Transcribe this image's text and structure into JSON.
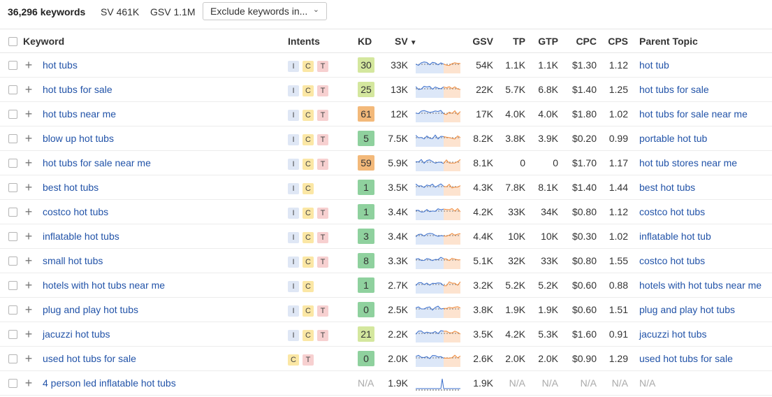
{
  "toolbar": {
    "keyword_count": "36,296 keywords",
    "sv": "SV 461K",
    "gsv": "GSV 1.1M",
    "filter_label": "Exclude keywords in..."
  },
  "columns": {
    "keyword": "Keyword",
    "intents": "Intents",
    "kd": "KD",
    "sv": "SV",
    "gsv": "GSV",
    "tp": "TP",
    "gtp": "GTP",
    "cpc": "CPC",
    "cps": "CPS",
    "parent": "Parent Topic"
  },
  "colors": {
    "link": "#2253a8",
    "kd_low": "#8fd19e",
    "kd_midlow": "#d4e79e",
    "kd_high": "#f3b97a",
    "spark_blue": "#3b6fcc",
    "spark_orange": "#ef8a3b"
  },
  "rows": [
    {
      "keyword": "hot tubs",
      "intents": [
        "I",
        "C",
        "T"
      ],
      "kd": "30",
      "sv": "33K",
      "gsv": "54K",
      "tp": "1.1K",
      "gtp": "1.1K",
      "cpc": "$1.30",
      "cps": "1.12",
      "parent": "hot tub"
    },
    {
      "keyword": "hot tubs for sale",
      "intents": [
        "I",
        "C",
        "T"
      ],
      "kd": "25",
      "sv": "13K",
      "gsv": "22K",
      "tp": "5.7K",
      "gtp": "6.8K",
      "cpc": "$1.40",
      "cps": "1.25",
      "parent": "hot tubs for sale"
    },
    {
      "keyword": "hot tubs near me",
      "intents": [
        "I",
        "C",
        "T"
      ],
      "kd": "61",
      "sv": "12K",
      "gsv": "17K",
      "tp": "4.0K",
      "gtp": "4.0K",
      "cpc": "$1.80",
      "cps": "1.02",
      "parent": "hot tubs for sale near me"
    },
    {
      "keyword": "blow up hot tubs",
      "intents": [
        "I",
        "C",
        "T"
      ],
      "kd": "5",
      "sv": "7.5K",
      "gsv": "8.2K",
      "tp": "3.8K",
      "gtp": "3.9K",
      "cpc": "$0.20",
      "cps": "0.99",
      "parent": "portable hot tub"
    },
    {
      "keyword": "hot tubs for sale near me",
      "intents": [
        "I",
        "C",
        "T"
      ],
      "kd": "59",
      "sv": "5.9K",
      "gsv": "8.1K",
      "tp": "0",
      "gtp": "0",
      "cpc": "$1.70",
      "cps": "1.17",
      "parent": "hot tub stores near me"
    },
    {
      "keyword": "best hot tubs",
      "intents": [
        "I",
        "C"
      ],
      "kd": "1",
      "sv": "3.5K",
      "gsv": "4.3K",
      "tp": "7.8K",
      "gtp": "8.1K",
      "cpc": "$1.40",
      "cps": "1.44",
      "parent": "best hot tubs"
    },
    {
      "keyword": "costco hot tubs",
      "intents": [
        "I",
        "C",
        "T"
      ],
      "kd": "1",
      "sv": "3.4K",
      "gsv": "4.2K",
      "tp": "33K",
      "gtp": "34K",
      "cpc": "$0.80",
      "cps": "1.12",
      "parent": "costco hot tubs"
    },
    {
      "keyword": "inflatable hot tubs",
      "intents": [
        "I",
        "C",
        "T"
      ],
      "kd": "3",
      "sv": "3.4K",
      "gsv": "4.4K",
      "tp": "10K",
      "gtp": "10K",
      "cpc": "$0.30",
      "cps": "1.02",
      "parent": "inflatable hot tub"
    },
    {
      "keyword": "small hot tubs",
      "intents": [
        "I",
        "C",
        "T"
      ],
      "kd": "8",
      "sv": "3.3K",
      "gsv": "5.1K",
      "tp": "32K",
      "gtp": "33K",
      "cpc": "$0.80",
      "cps": "1.55",
      "parent": "costco hot tubs"
    },
    {
      "keyword": "hotels with hot tubs near me",
      "intents": [
        "I",
        "C"
      ],
      "kd": "1",
      "sv": "2.7K",
      "gsv": "3.2K",
      "tp": "5.2K",
      "gtp": "5.2K",
      "cpc": "$0.60",
      "cps": "0.88",
      "parent": "hotels with hot tubs near me"
    },
    {
      "keyword": "plug and play hot tubs",
      "intents": [
        "I",
        "C",
        "T"
      ],
      "kd": "0",
      "sv": "2.5K",
      "gsv": "3.8K",
      "tp": "1.9K",
      "gtp": "1.9K",
      "cpc": "$0.60",
      "cps": "1.51",
      "parent": "plug and play hot tubs"
    },
    {
      "keyword": "jacuzzi hot tubs",
      "intents": [
        "I",
        "C",
        "T"
      ],
      "kd": "21",
      "sv": "2.2K",
      "gsv": "3.5K",
      "tp": "4.2K",
      "gtp": "5.3K",
      "cpc": "$1.60",
      "cps": "0.91",
      "parent": "jacuzzi hot tubs"
    },
    {
      "keyword": "used hot tubs for sale",
      "intents": [
        "C",
        "T"
      ],
      "kd": "0",
      "sv": "2.0K",
      "gsv": "2.6K",
      "tp": "2.0K",
      "gtp": "2.0K",
      "cpc": "$0.90",
      "cps": "1.29",
      "parent": "used hot tubs for sale"
    },
    {
      "keyword": "4 person led inflatable hot tubs",
      "intents": [],
      "kd": "N/A",
      "sv": "1.9K",
      "gsv": "1.9K",
      "tp": "N/A",
      "gtp": "N/A",
      "cpc": "N/A",
      "cps": "N/A",
      "parent": "N/A"
    }
  ]
}
